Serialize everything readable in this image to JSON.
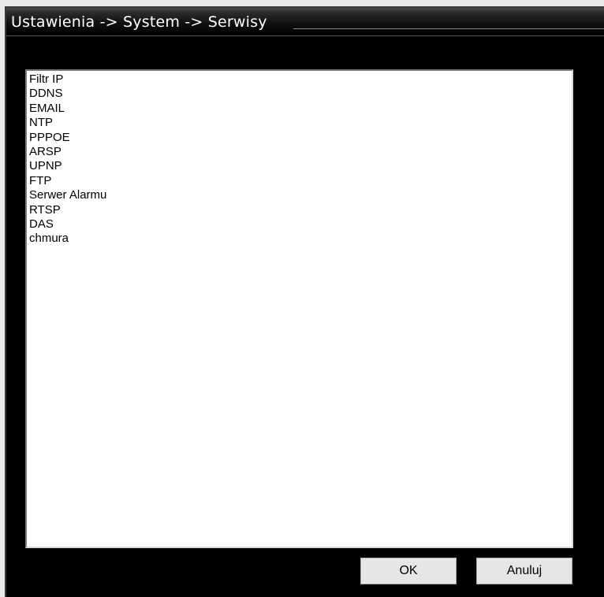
{
  "window": {
    "title": "Ustawienia -> System -> Serwisy"
  },
  "services": {
    "items": [
      "Filtr IP",
      "DDNS",
      "EMAIL",
      "NTP",
      "PPPOE",
      "ARSP",
      "UPNP",
      "FTP",
      "Serwer Alarmu",
      "RTSP",
      "DAS",
      "chmura"
    ]
  },
  "buttons": {
    "ok_label": "OK",
    "cancel_label": "Anuluj"
  }
}
